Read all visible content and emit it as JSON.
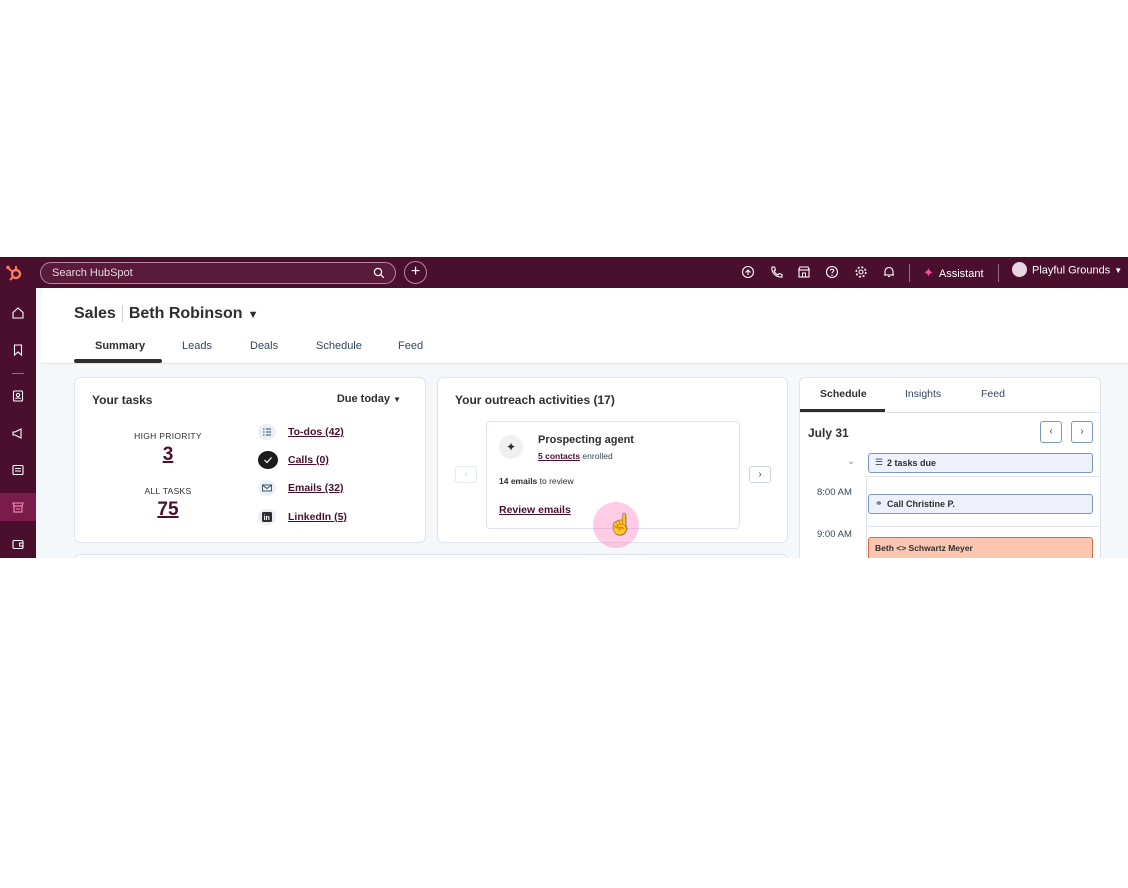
{
  "topbar": {
    "search_placeholder": "Search HubSpot",
    "plus_label": "+",
    "assistant_label": "Assistant",
    "account_name": "Playful Grounds"
  },
  "header": {
    "section": "Sales",
    "owner": "Beth Robinson",
    "tabs": [
      "Summary",
      "Leads",
      "Deals",
      "Schedule",
      "Feed"
    ]
  },
  "tasks": {
    "title": "Your tasks",
    "filter": "Due today",
    "high_priority_label": "HIGH PRIORITY",
    "high_priority_count": "3",
    "all_tasks_label": "ALL TASKS",
    "all_tasks_count": "75",
    "items": [
      {
        "label": "To-dos (42)",
        "icon": "todo-list-icon"
      },
      {
        "label": "Calls (0)",
        "icon": "check-circle-icon"
      },
      {
        "label": "Emails (32)",
        "icon": "envelope-icon"
      },
      {
        "label": "LinkedIn (5)",
        "icon": "linkedin-icon"
      }
    ]
  },
  "outreach": {
    "title": "Your outreach activities (17)",
    "agent_title": "Prospecting agent",
    "contacts_link": "5 contacts",
    "enrolled_text": "enrolled",
    "emails_count": "14 emails",
    "emails_suffix": "to review",
    "review_link": "Review emails",
    "prev_label": "‹",
    "next_label": "›"
  },
  "schedule": {
    "tabs": [
      "Schedule",
      "Insights",
      "Feed"
    ],
    "date": "July 31",
    "prev_label": "‹",
    "next_label": "›",
    "tasks_due": "2 tasks due",
    "times": [
      "8:00 AM",
      "9:00 AM"
    ],
    "call_item": "Call Christine P.",
    "meeting_item": "Beth <> Schwartz Meyer"
  },
  "colors": {
    "brand_dark": "#4b0f2e",
    "accent_orange": "#ff7a59",
    "event_bg": "#fcc6b1"
  }
}
